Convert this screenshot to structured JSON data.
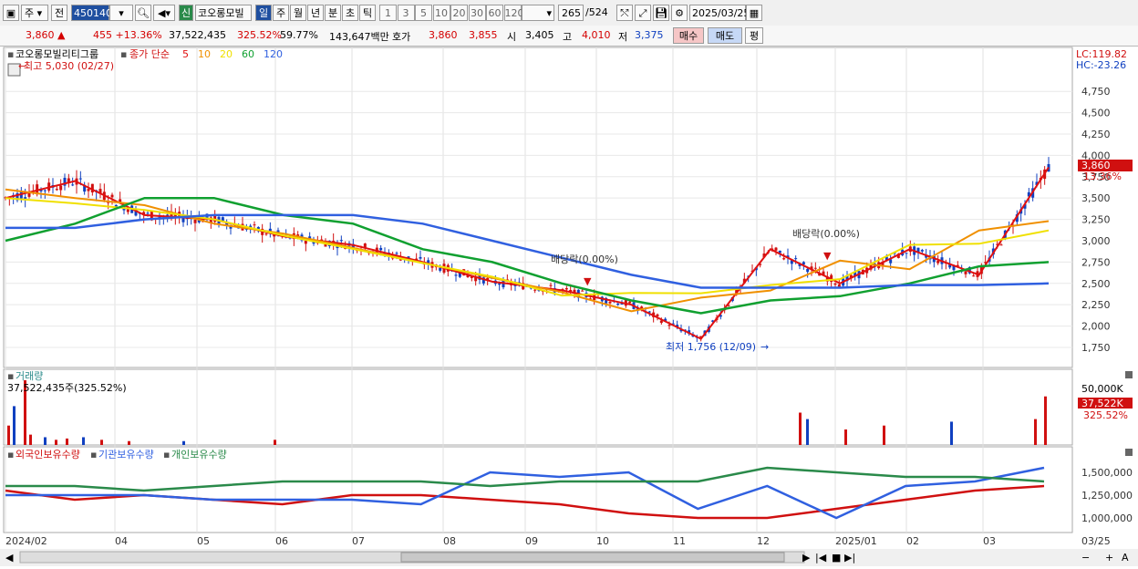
{
  "toolbar": {
    "period_label": "주",
    "prev_label": "전",
    "code": "450140",
    "new_badge": "신",
    "name": "코오롱모빌",
    "periods": [
      "일",
      "주",
      "월",
      "년",
      "분",
      "초",
      "틱"
    ],
    "active_period": "일",
    "intervals": [
      "1",
      "3",
      "5",
      "10",
      "20",
      "30",
      "60",
      "120"
    ],
    "count": "265",
    "count_total": "/524",
    "date": "2025/03/25"
  },
  "quote": {
    "price": "3,860 ▲",
    "change": "455 +13.36%",
    "volume": "37,522,435",
    "vol_ratio": "325.52%",
    "turnover": "59.77%",
    "amount": "143,647백만",
    "hoga_label": "호가",
    "ask": "3,860",
    "bid": "3,855",
    "open_label": "시",
    "open": "3,405",
    "high_label": "고",
    "high": "4,010",
    "low_label": "저",
    "low": "3,375",
    "buy_label": "매수",
    "sell_label": "매도",
    "eval_label": "평"
  },
  "price_panel": {
    "title": "코오롱모빌리티그룹",
    "ma_label": "종가 단순",
    "ma_periods": [
      "5",
      "10",
      "20",
      "60",
      "120"
    ],
    "ma_colors": [
      "#e01010",
      "#f09000",
      "#f0e000",
      "#10a030",
      "#3060e0"
    ],
    "lc": "LC:119.82",
    "hc": "HC:-23.26",
    "high_note": "최고 5,030 (02/27)",
    "low_note": "최저 1,756 (12/09)",
    "div_note1": "배당락(0.00%)",
    "div_note2": "배당락(0.00%)",
    "last_price": "3,860",
    "last_pct": "13.36%"
  },
  "volume_panel": {
    "title": "거래량",
    "info": "37,522,435주(325.52%)",
    "axis_top": "50,000K",
    "last": "37,522K",
    "last_pct": "325.52%"
  },
  "holding_panel": {
    "labels": [
      "외국인보유수량",
      "기관보유수량",
      "개인보유수량"
    ],
    "colors": [
      "#d01010",
      "#3060e0",
      "#2a8a4a"
    ]
  },
  "x_axis": [
    "2024/02",
    "04",
    "05",
    "06",
    "07",
    "08",
    "09",
    "10",
    "11",
    "12",
    "2025/01",
    "02",
    "03",
    "03/25"
  ],
  "chart_data": [
    {
      "type": "line",
      "title": "코오롱모빌리티그룹",
      "series_name": "종가 단순",
      "x": [
        "2024/02/27",
        "2024/03",
        "2024/04",
        "2024/05",
        "2024/06",
        "2024/07",
        "2024/08",
        "2024/09",
        "2024/10",
        "2024/11",
        "2024/12/09",
        "2024/12/20",
        "2025/01",
        "2025/02",
        "2025/03",
        "2025/03/25"
      ],
      "close": [
        3500,
        3700,
        3300,
        3250,
        3050,
        2950,
        2750,
        2520,
        2420,
        2250,
        1850,
        2900,
        2500,
        2900,
        2600,
        3860
      ],
      "ma60": [
        3000,
        3200,
        3500,
        3500,
        3300,
        3200,
        2900,
        2750,
        2500,
        2300,
        2150,
        2300,
        2350,
        2500,
        2700,
        2750
      ],
      "ma120": [
        3150,
        3150,
        3250,
        3300,
        3300,
        3300,
        3200,
        3000,
        2800,
        2600,
        2450,
        2450,
        2450,
        2480,
        2480,
        2500
      ],
      "ylim": [
        1600,
        5030
      ],
      "yticks": [
        1750,
        2000,
        2250,
        2500,
        2750,
        3000,
        3250,
        3500,
        3750,
        4000,
        4250,
        4500,
        4750
      ]
    },
    {
      "type": "bar",
      "title": "거래량",
      "values_k": [
        15000,
        30000,
        50000,
        8000,
        6000,
        4000,
        5000,
        6000,
        4000,
        3000,
        3000,
        4000,
        25000,
        20000,
        12000,
        15000,
        18000,
        20000,
        37522
      ],
      "ylim": [
        0,
        50000
      ]
    },
    {
      "type": "line",
      "series": [
        {
          "name": "외국인보유수량",
          "values": [
            1300000,
            1200000,
            1250000,
            1200000,
            1150000,
            1250000,
            1250000,
            1200000,
            1150000,
            1050000,
            1000000,
            1000000,
            1100000,
            1200000,
            1300000,
            1350000
          ]
        },
        {
          "name": "기관보유수량",
          "values": [
            1250000,
            1250000,
            1250000,
            1200000,
            1200000,
            1200000,
            1150000,
            1500000,
            1450000,
            1500000,
            1100000,
            1350000,
            1000000,
            1350000,
            1400000,
            1550000
          ]
        },
        {
          "name": "개인보유수량",
          "values": [
            1350000,
            1350000,
            1300000,
            1350000,
            1400000,
            1400000,
            1400000,
            1350000,
            1400000,
            1400000,
            1400000,
            1550000,
            1500000,
            1450000,
            1450000,
            1400000
          ]
        }
      ],
      "yticks": [
        1000000,
        1250000,
        1500000
      ]
    }
  ]
}
